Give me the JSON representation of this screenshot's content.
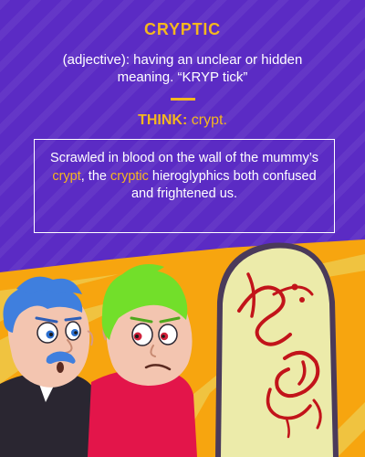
{
  "word": "CRYPTIC",
  "definition": "(adjective): having an unclear or hidden meaning. “KRYP tick”",
  "think": {
    "label": "THINK:",
    "value": "crypt."
  },
  "sentence": {
    "part1": "Scrawled in blood on the wall of the mummy’s ",
    "highlight1": "crypt",
    "part2": ", the ",
    "highlight2": "cryptic",
    "part3": " hieroglyphics both confused and frightened us."
  },
  "colors": {
    "background": "#5b2bc4",
    "accent": "#f4b71f",
    "text": "#ffffff",
    "wall": "#f7a50f",
    "tablet": "#ecebaa",
    "blood": "#c2141a"
  }
}
